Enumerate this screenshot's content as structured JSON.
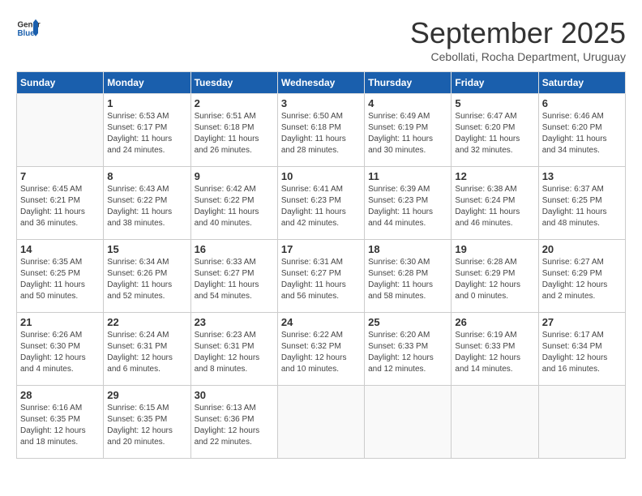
{
  "logo": {
    "general": "General",
    "blue": "Blue"
  },
  "title": "September 2025",
  "subtitle": "Cebollati, Rocha Department, Uruguay",
  "weekdays": [
    "Sunday",
    "Monday",
    "Tuesday",
    "Wednesday",
    "Thursday",
    "Friday",
    "Saturday"
  ],
  "weeks": [
    [
      {
        "day": "",
        "sunrise": "",
        "sunset": "",
        "daylight": ""
      },
      {
        "day": "1",
        "sunrise": "Sunrise: 6:53 AM",
        "sunset": "Sunset: 6:17 PM",
        "daylight": "Daylight: 11 hours and 24 minutes."
      },
      {
        "day": "2",
        "sunrise": "Sunrise: 6:51 AM",
        "sunset": "Sunset: 6:18 PM",
        "daylight": "Daylight: 11 hours and 26 minutes."
      },
      {
        "day": "3",
        "sunrise": "Sunrise: 6:50 AM",
        "sunset": "Sunset: 6:18 PM",
        "daylight": "Daylight: 11 hours and 28 minutes."
      },
      {
        "day": "4",
        "sunrise": "Sunrise: 6:49 AM",
        "sunset": "Sunset: 6:19 PM",
        "daylight": "Daylight: 11 hours and 30 minutes."
      },
      {
        "day": "5",
        "sunrise": "Sunrise: 6:47 AM",
        "sunset": "Sunset: 6:20 PM",
        "daylight": "Daylight: 11 hours and 32 minutes."
      },
      {
        "day": "6",
        "sunrise": "Sunrise: 6:46 AM",
        "sunset": "Sunset: 6:20 PM",
        "daylight": "Daylight: 11 hours and 34 minutes."
      }
    ],
    [
      {
        "day": "7",
        "sunrise": "Sunrise: 6:45 AM",
        "sunset": "Sunset: 6:21 PM",
        "daylight": "Daylight: 11 hours and 36 minutes."
      },
      {
        "day": "8",
        "sunrise": "Sunrise: 6:43 AM",
        "sunset": "Sunset: 6:22 PM",
        "daylight": "Daylight: 11 hours and 38 minutes."
      },
      {
        "day": "9",
        "sunrise": "Sunrise: 6:42 AM",
        "sunset": "Sunset: 6:22 PM",
        "daylight": "Daylight: 11 hours and 40 minutes."
      },
      {
        "day": "10",
        "sunrise": "Sunrise: 6:41 AM",
        "sunset": "Sunset: 6:23 PM",
        "daylight": "Daylight: 11 hours and 42 minutes."
      },
      {
        "day": "11",
        "sunrise": "Sunrise: 6:39 AM",
        "sunset": "Sunset: 6:23 PM",
        "daylight": "Daylight: 11 hours and 44 minutes."
      },
      {
        "day": "12",
        "sunrise": "Sunrise: 6:38 AM",
        "sunset": "Sunset: 6:24 PM",
        "daylight": "Daylight: 11 hours and 46 minutes."
      },
      {
        "day": "13",
        "sunrise": "Sunrise: 6:37 AM",
        "sunset": "Sunset: 6:25 PM",
        "daylight": "Daylight: 11 hours and 48 minutes."
      }
    ],
    [
      {
        "day": "14",
        "sunrise": "Sunrise: 6:35 AM",
        "sunset": "Sunset: 6:25 PM",
        "daylight": "Daylight: 11 hours and 50 minutes."
      },
      {
        "day": "15",
        "sunrise": "Sunrise: 6:34 AM",
        "sunset": "Sunset: 6:26 PM",
        "daylight": "Daylight: 11 hours and 52 minutes."
      },
      {
        "day": "16",
        "sunrise": "Sunrise: 6:33 AM",
        "sunset": "Sunset: 6:27 PM",
        "daylight": "Daylight: 11 hours and 54 minutes."
      },
      {
        "day": "17",
        "sunrise": "Sunrise: 6:31 AM",
        "sunset": "Sunset: 6:27 PM",
        "daylight": "Daylight: 11 hours and 56 minutes."
      },
      {
        "day": "18",
        "sunrise": "Sunrise: 6:30 AM",
        "sunset": "Sunset: 6:28 PM",
        "daylight": "Daylight: 11 hours and 58 minutes."
      },
      {
        "day": "19",
        "sunrise": "Sunrise: 6:28 AM",
        "sunset": "Sunset: 6:29 PM",
        "daylight": "Daylight: 12 hours and 0 minutes."
      },
      {
        "day": "20",
        "sunrise": "Sunrise: 6:27 AM",
        "sunset": "Sunset: 6:29 PM",
        "daylight": "Daylight: 12 hours and 2 minutes."
      }
    ],
    [
      {
        "day": "21",
        "sunrise": "Sunrise: 6:26 AM",
        "sunset": "Sunset: 6:30 PM",
        "daylight": "Daylight: 12 hours and 4 minutes."
      },
      {
        "day": "22",
        "sunrise": "Sunrise: 6:24 AM",
        "sunset": "Sunset: 6:31 PM",
        "daylight": "Daylight: 12 hours and 6 minutes."
      },
      {
        "day": "23",
        "sunrise": "Sunrise: 6:23 AM",
        "sunset": "Sunset: 6:31 PM",
        "daylight": "Daylight: 12 hours and 8 minutes."
      },
      {
        "day": "24",
        "sunrise": "Sunrise: 6:22 AM",
        "sunset": "Sunset: 6:32 PM",
        "daylight": "Daylight: 12 hours and 10 minutes."
      },
      {
        "day": "25",
        "sunrise": "Sunrise: 6:20 AM",
        "sunset": "Sunset: 6:33 PM",
        "daylight": "Daylight: 12 hours and 12 minutes."
      },
      {
        "day": "26",
        "sunrise": "Sunrise: 6:19 AM",
        "sunset": "Sunset: 6:33 PM",
        "daylight": "Daylight: 12 hours and 14 minutes."
      },
      {
        "day": "27",
        "sunrise": "Sunrise: 6:17 AM",
        "sunset": "Sunset: 6:34 PM",
        "daylight": "Daylight: 12 hours and 16 minutes."
      }
    ],
    [
      {
        "day": "28",
        "sunrise": "Sunrise: 6:16 AM",
        "sunset": "Sunset: 6:35 PM",
        "daylight": "Daylight: 12 hours and 18 minutes."
      },
      {
        "day": "29",
        "sunrise": "Sunrise: 6:15 AM",
        "sunset": "Sunset: 6:35 PM",
        "daylight": "Daylight: 12 hours and 20 minutes."
      },
      {
        "day": "30",
        "sunrise": "Sunrise: 6:13 AM",
        "sunset": "Sunset: 6:36 PM",
        "daylight": "Daylight: 12 hours and 22 minutes."
      },
      {
        "day": "",
        "sunrise": "",
        "sunset": "",
        "daylight": ""
      },
      {
        "day": "",
        "sunrise": "",
        "sunset": "",
        "daylight": ""
      },
      {
        "day": "",
        "sunrise": "",
        "sunset": "",
        "daylight": ""
      },
      {
        "day": "",
        "sunrise": "",
        "sunset": "",
        "daylight": ""
      }
    ]
  ]
}
